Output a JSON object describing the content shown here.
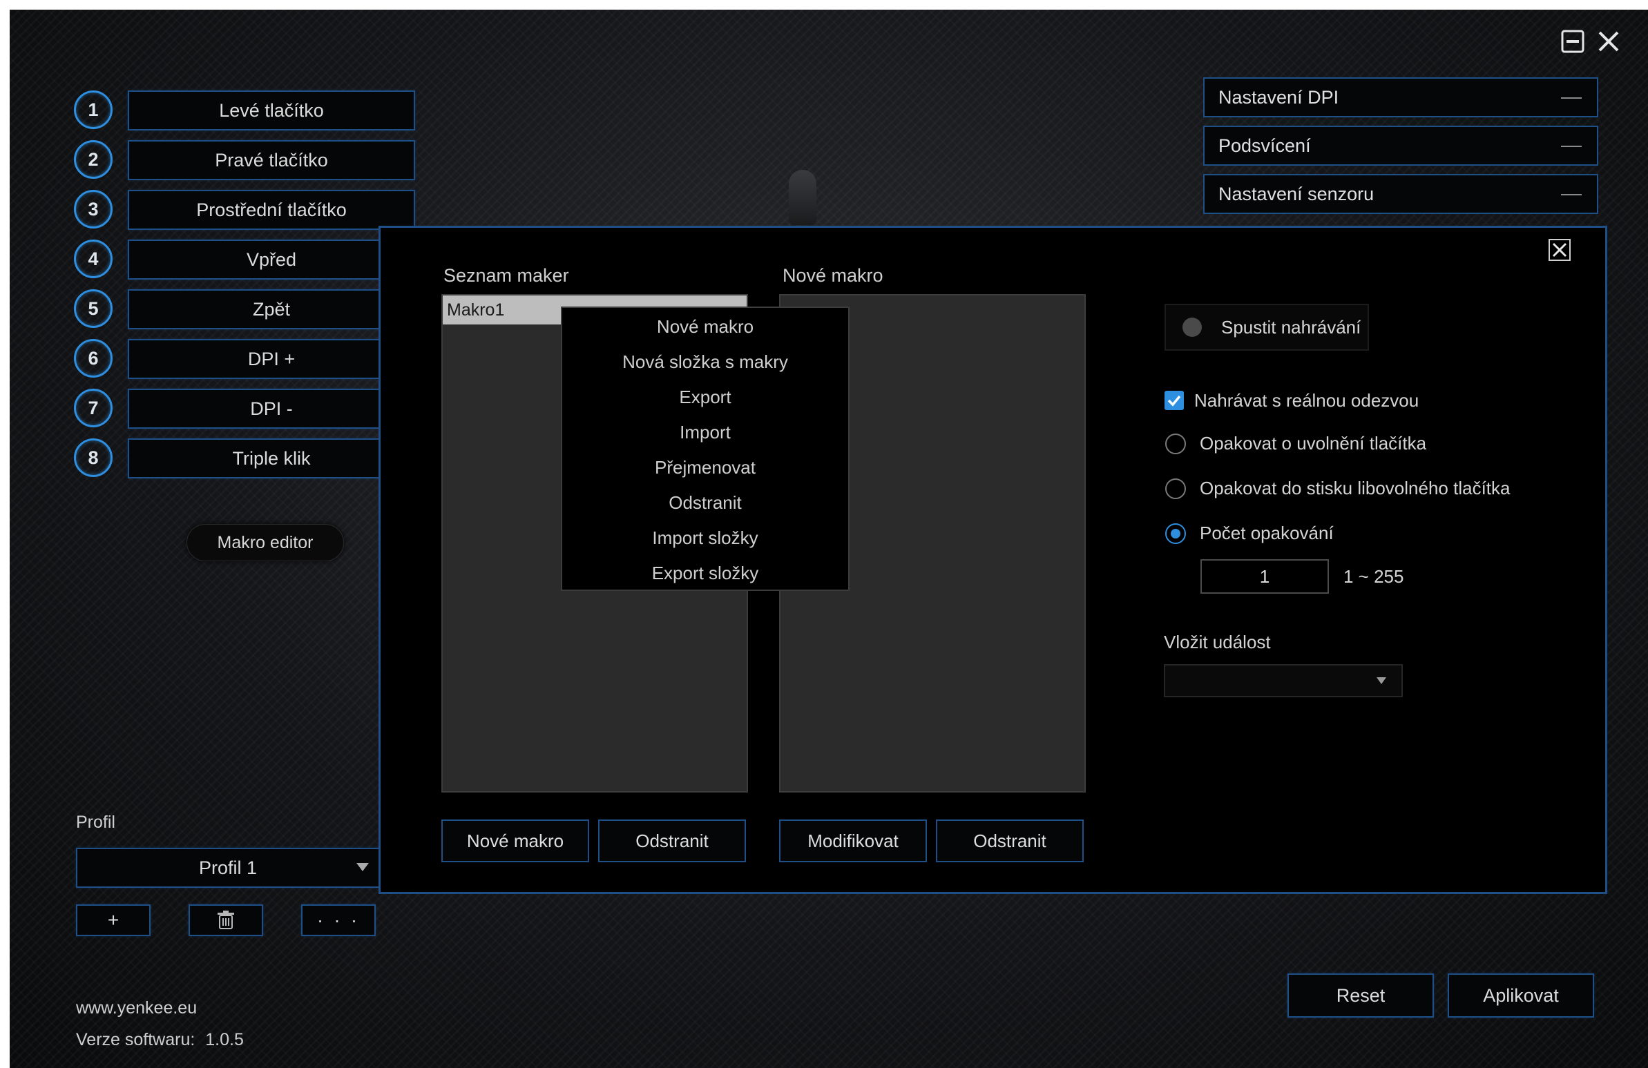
{
  "window": {
    "minimize_icon": "minimize-icon",
    "close_icon": "close-icon"
  },
  "buttons": [
    {
      "num": "1",
      "label": "Levé tlačítko"
    },
    {
      "num": "2",
      "label": "Pravé tlačítko"
    },
    {
      "num": "3",
      "label": "Prostřední tlačítko"
    },
    {
      "num": "4",
      "label": "Vpřed"
    },
    {
      "num": "5",
      "label": "Zpět"
    },
    {
      "num": "6",
      "label": "DPI +"
    },
    {
      "num": "7",
      "label": "DPI -"
    },
    {
      "num": "8",
      "label": "Triple klik"
    }
  ],
  "macro_editor_label": "Makro editor",
  "profile": {
    "label": "Profil",
    "selected": "Profil 1",
    "add_label": "+",
    "more_label": "· · ·"
  },
  "footer": {
    "website": "www.yenkee.eu",
    "version_label": "Verze softwaru:",
    "version": "1.0.5"
  },
  "right_sections": [
    {
      "label": "Nastavení DPI"
    },
    {
      "label": "Podsvícení"
    },
    {
      "label": "Nastavení senzoru"
    }
  ],
  "actions": {
    "reset": "Reset",
    "apply": "Aplikovat"
  },
  "dialog": {
    "macro_list_title": "Seznam maker",
    "new_macro_title": "Nové makro",
    "macro_items": [
      "Makro1"
    ],
    "context_menu": [
      "Nové makro",
      "Nová složka s makry",
      "Export",
      "Import",
      "Přejmenovat",
      "Odstranit",
      "Import složky",
      "Export složky"
    ],
    "list_buttons": {
      "new": "Nové makro",
      "delete": "Odstranit"
    },
    "macro_buttons": {
      "modify": "Modifikovat",
      "delete": "Odstranit"
    },
    "record_label": "Spustit nahrávání",
    "realtime_label": "Nahrávat s reálnou odezvou",
    "realtime_checked": true,
    "repeat_options": [
      {
        "label": "Opakovat o uvolnění tlačítka",
        "selected": false
      },
      {
        "label": "Opakovat do stisku libovolného tlačítka",
        "selected": false
      },
      {
        "label": "Počet opakování",
        "selected": true
      }
    ],
    "repeat_count": "1",
    "repeat_range": "1 ~ 255",
    "insert_event_label": "Vložit událost",
    "insert_event_value": ""
  },
  "colors": {
    "accent": "#2e8fe0",
    "border": "#1e4f86"
  }
}
